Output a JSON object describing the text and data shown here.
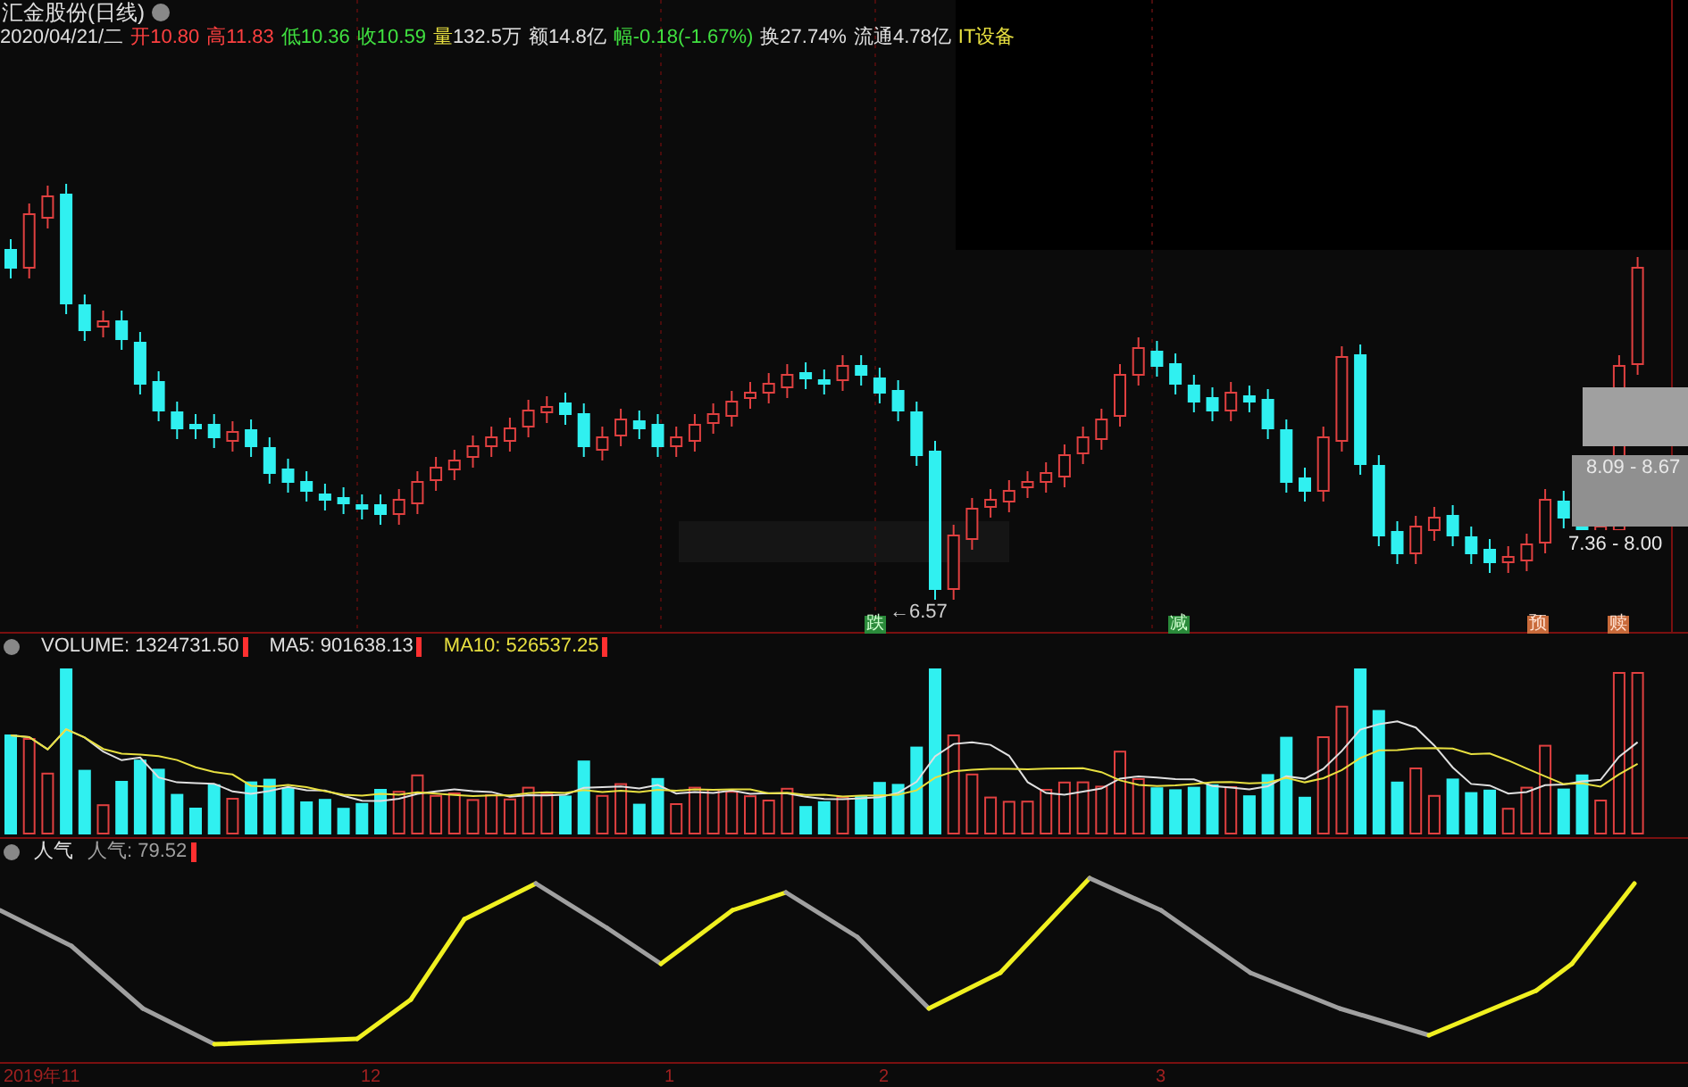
{
  "chart_title": "汇金股份(日线)",
  "date": "2020/04/21/二",
  "quote_items": [
    {
      "label": "开",
      "value": "10.80",
      "kind": "up"
    },
    {
      "label": "高",
      "value": "11.83",
      "kind": "up"
    },
    {
      "label": "低",
      "value": "10.36",
      "kind": "down"
    },
    {
      "label": "收",
      "value": "10.59",
      "kind": "down"
    },
    {
      "label": "量",
      "value": "132.5万",
      "kind": "volume"
    },
    {
      "label": "额",
      "value": "14.8亿",
      "kind": "plain"
    },
    {
      "label": "幅",
      "value": "-0.18(-1.67%)",
      "kind": "down"
    },
    {
      "label": "换",
      "value": "27.74%",
      "kind": "plain"
    },
    {
      "label": "流通",
      "value": "4.78亿",
      "kind": "plain"
    },
    {
      "label": "IT设备",
      "value": "",
      "kind": "sector"
    }
  ],
  "price_labels": [
    {
      "text": "←6.57",
      "kind": "low"
    },
    {
      "text": "8.09 - 8.67",
      "kind": "range_upper"
    },
    {
      "text": "7.36 - 8.00",
      "kind": "range_lower"
    }
  ],
  "signals": [
    {
      "text": "跌",
      "kind": "sell"
    },
    {
      "text": "减",
      "kind": "sell"
    },
    {
      "text": "预",
      "kind": "notice"
    },
    {
      "text": "赎",
      "kind": "notice"
    }
  ],
  "volume_header": [
    {
      "text": "VOLUME: 1324731.50",
      "kind": "volume"
    },
    {
      "text": "MA5: 901638.13",
      "kind": "ma5"
    },
    {
      "text": "MA10: 526537.25",
      "kind": "ma10"
    }
  ],
  "indicator_header": {
    "name": "人气",
    "reading": "人气: 79.52"
  },
  "time_axis": [
    "2019年11",
    "12",
    "1",
    "2",
    "3"
  ]
}
